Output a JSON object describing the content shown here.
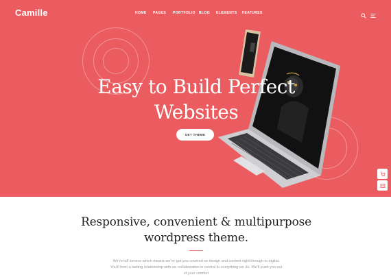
{
  "brand": {
    "logo": "Camille"
  },
  "nav": {
    "items": [
      {
        "label": "HOME"
      },
      {
        "label": "PAGES"
      },
      {
        "label": "PORTFOLIO"
      },
      {
        "label": "BLOG"
      },
      {
        "label": "ELEMENTS"
      },
      {
        "label": "FEATURES"
      }
    ],
    "icons": [
      "search-icon",
      "menu-icon"
    ]
  },
  "hero": {
    "headline_line1": "Easy to Build Perfect",
    "headline_line2": "Websites",
    "cta_label": "GET THEME",
    "background_color": "#ea5c5f"
  },
  "side_buttons": [
    "cart-icon",
    "layout-icon"
  ],
  "intro": {
    "title_line1": "Responsive, convenient & multipurpose",
    "title_line2": "wordpress theme.",
    "body": "We're full service which means we've got you covered on design and content right through to digital. You'll form a lasting relationship with us, collaboration is central to everything we do. We'll push you out of your comfort"
  }
}
